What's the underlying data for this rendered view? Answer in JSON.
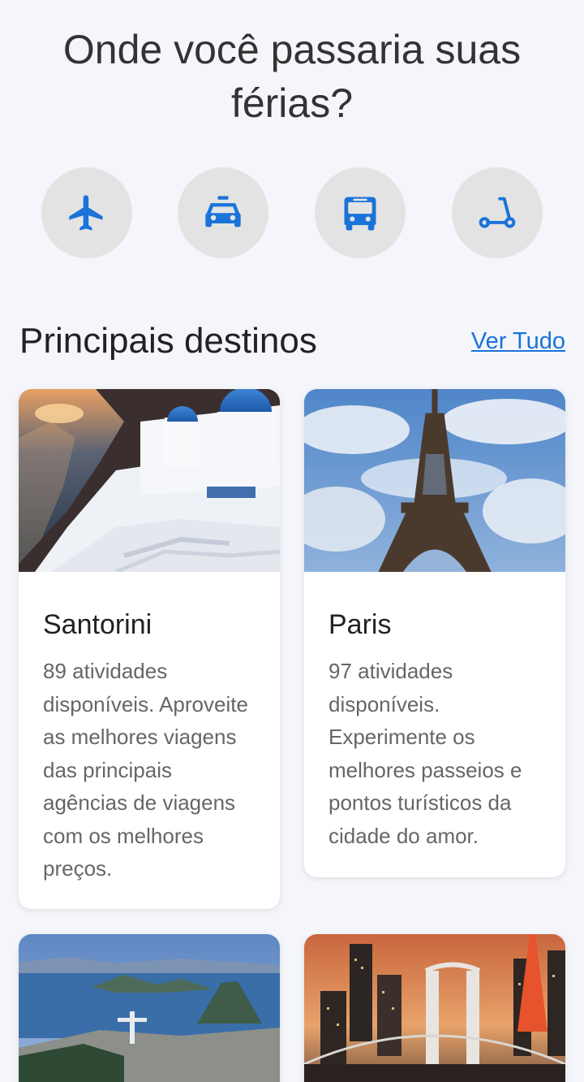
{
  "header": {
    "title": "Onde você passaria suas férias?"
  },
  "transport": [
    {
      "icon": "airplane-icon"
    },
    {
      "icon": "taxi-icon"
    },
    {
      "icon": "bus-icon"
    },
    {
      "icon": "scooter-icon"
    }
  ],
  "section": {
    "title": "Principais destinos",
    "see_all": "Ver Tudo"
  },
  "destinations": [
    {
      "name": "Santorini",
      "description": "89 atividades disponíveis. Aproveite as melhores viagens das principais agências de viagens com os melhores preços."
    },
    {
      "name": "Paris",
      "description": "97 atividades disponíveis. Experimente os melhores passeios e pontos turísticos da cidade do amor."
    },
    {
      "name": "",
      "description": ""
    },
    {
      "name": "",
      "description": ""
    }
  ],
  "colors": {
    "accent": "#1a73d9",
    "background": "#f4f6fb",
    "icon_bg": "#e3e3e3"
  }
}
